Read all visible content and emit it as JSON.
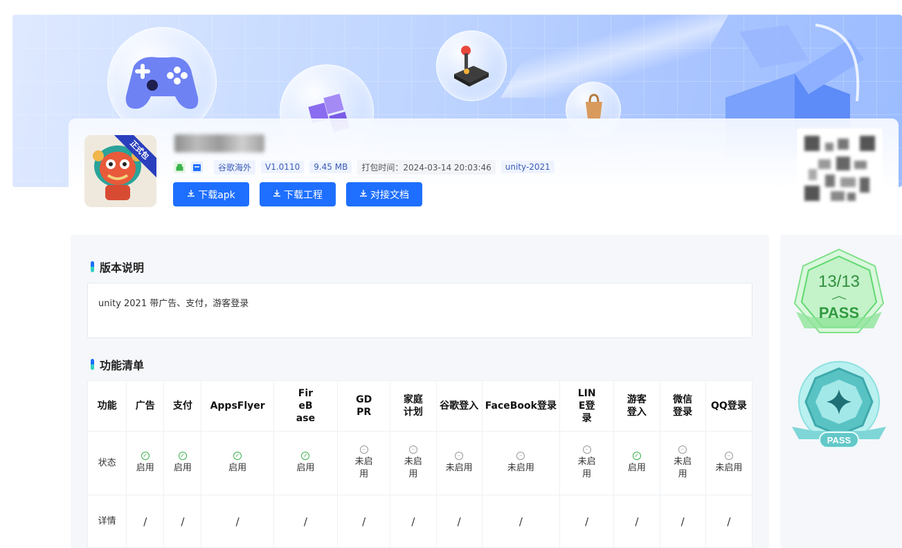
{
  "app": {
    "badge": "正式包",
    "platform_icon": "android-icon",
    "store_icon": "store-icon",
    "tags": [
      "谷歌海外",
      "V1.0110",
      "9.45 MB",
      "打包时间：2024-03-14 20:03:46",
      "unity-2021"
    ]
  },
  "buttons": {
    "download_apk": "下载apk",
    "download_project": "下载工程",
    "docs": "对接文档"
  },
  "version_section": {
    "title": "版本说明",
    "text": "unity 2021 带广告、支付，游客登录"
  },
  "feature_section": {
    "title": "功能清单",
    "row_labels": {
      "feature": "功能",
      "status": "状态",
      "detail": "详情"
    },
    "columns": [
      {
        "name": "广告",
        "status": "启用",
        "enabled": true,
        "detail": "/"
      },
      {
        "name": "支付",
        "status": "启用",
        "enabled": true,
        "detail": "/"
      },
      {
        "name": "AppsFlyer",
        "status": "启用",
        "enabled": true,
        "detail": "/"
      },
      {
        "name": "FireBase",
        "status": "启用",
        "enabled": true,
        "detail": "/"
      },
      {
        "name": "GDPR",
        "status": "未启用",
        "enabled": false,
        "detail": "/"
      },
      {
        "name": "家庭计划",
        "status": "未启用",
        "enabled": false,
        "detail": "/"
      },
      {
        "name": "谷歌登入",
        "status": "未启用",
        "enabled": false,
        "detail": "/"
      },
      {
        "name": "FaceBook登录",
        "status": "未启用",
        "enabled": false,
        "detail": "/"
      },
      {
        "name": "LINE登录",
        "status": "未启用",
        "enabled": false,
        "detail": "/"
      },
      {
        "name": "游客登入",
        "status": "启用",
        "enabled": true,
        "detail": "/"
      },
      {
        "name": "微信登录",
        "status": "未启用",
        "enabled": false,
        "detail": "/"
      },
      {
        "name": "QQ登录",
        "status": "未启用",
        "enabled": false,
        "detail": "/"
      }
    ]
  },
  "badges": {
    "score": "13/13",
    "pass_label": "PASS",
    "pass_label_2": "PASS"
  },
  "colors": {
    "primary": "#1e6fff",
    "success": "#38b24a",
    "badge_green": "#5fd86f",
    "badge_teal": "#4fc6c7"
  }
}
